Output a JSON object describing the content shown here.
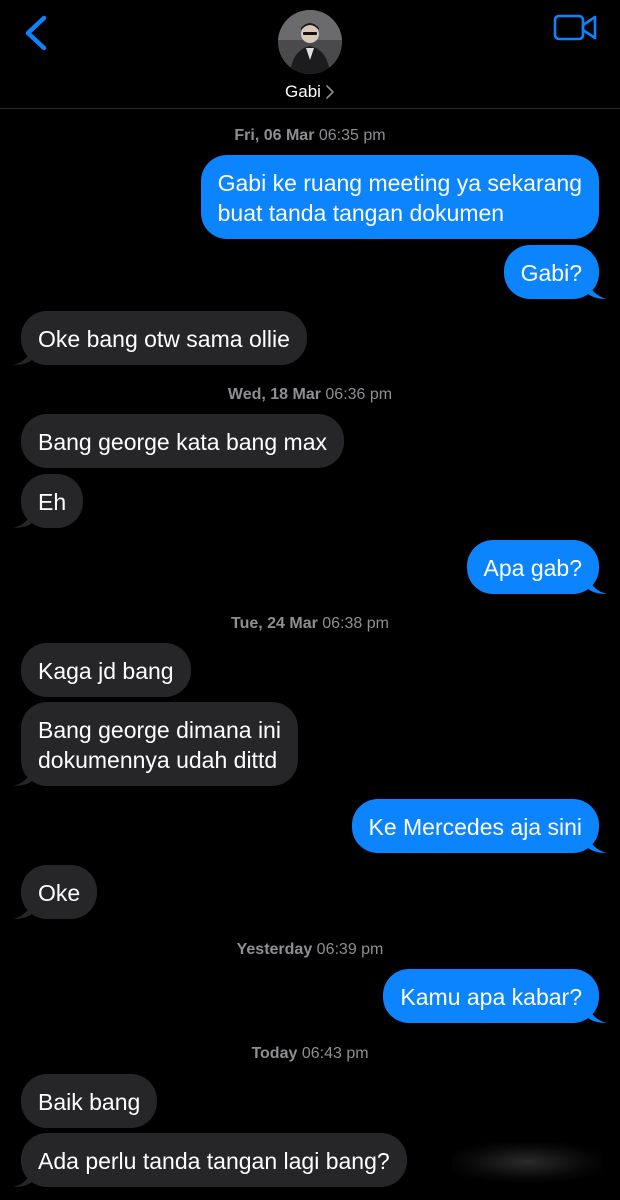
{
  "header": {
    "contact_name": "Gabi",
    "back_icon": "chevron-left-icon",
    "video_icon": "video-camera-icon",
    "accent_color": "#0b84fe"
  },
  "conversation": {
    "timestamps": [
      {
        "day": "Fri, 06 Mar",
        "time": "06:35 pm"
      },
      {
        "day": "Wed, 18 Mar",
        "time": "06:36 pm"
      },
      {
        "day": "Tue, 24 Mar",
        "time": "06:38 pm"
      },
      {
        "day": "Yesterday",
        "time": "06:39 pm"
      },
      {
        "day": "Today",
        "time": "06:43 pm"
      }
    ],
    "messages": [
      {
        "from": "me",
        "lines": [
          "Gabi ke ruang meeting ya sekarang",
          "buat tanda tangan dokumen"
        ]
      },
      {
        "from": "me",
        "lines": [
          "Gabi?"
        ]
      },
      {
        "from": "them",
        "lines": [
          "Oke bang otw sama ollie"
        ]
      },
      {
        "from": "them",
        "lines": [
          "Bang george kata bang max"
        ]
      },
      {
        "from": "them",
        "lines": [
          "Eh"
        ]
      },
      {
        "from": "me",
        "lines": [
          "Apa gab?"
        ]
      },
      {
        "from": "them",
        "lines": [
          "Kaga jd bang"
        ]
      },
      {
        "from": "them",
        "lines": [
          "Bang george dimana ini",
          "dokumennya udah dittd"
        ]
      },
      {
        "from": "me",
        "lines": [
          "Ke Mercedes aja sini"
        ]
      },
      {
        "from": "them",
        "lines": [
          "Oke"
        ]
      },
      {
        "from": "me",
        "lines": [
          "Kamu apa kabar?"
        ]
      },
      {
        "from": "them",
        "lines": [
          "Baik bang"
        ]
      },
      {
        "from": "them",
        "lines": [
          "Ada perlu tanda tangan lagi bang?"
        ]
      }
    ],
    "colors": {
      "sent_bubble": "#0b84fe",
      "received_bubble": "#262628",
      "timestamp_text": "#8e8e93",
      "background": "#000000"
    }
  }
}
